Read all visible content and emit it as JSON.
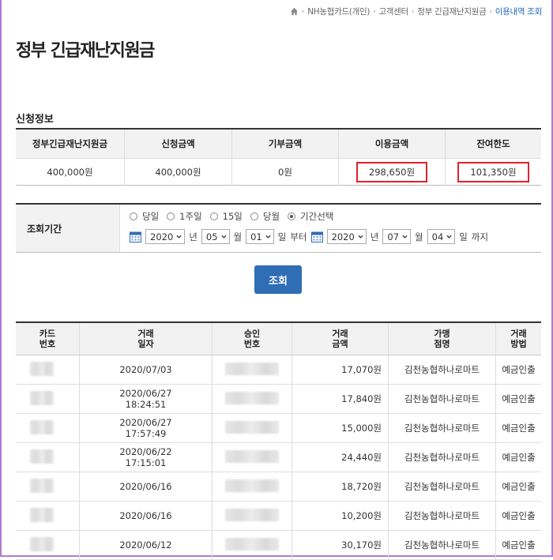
{
  "breadcrumb": {
    "items": [
      "NH농협카드(개인)",
      "고객센터",
      "정부 긴급재난지원금"
    ],
    "current": "이용내역 조회",
    "separator": "›"
  },
  "page_title": "정부 긴급재난지원금",
  "section_title": "신청정보",
  "info_table": {
    "headers": [
      "정부긴급재난지원금",
      "신청금액",
      "기부금액",
      "이용금액",
      "잔여한도"
    ],
    "values": [
      "400,000원",
      "400,000원",
      "0원",
      "298,650원",
      "101,350원"
    ]
  },
  "period": {
    "label": "조회기간",
    "options": [
      "당일",
      "1주일",
      "15일",
      "당월",
      "기간선택"
    ],
    "selected_index": 4,
    "start": {
      "year": "2020",
      "month": "05",
      "day": "01"
    },
    "end": {
      "year": "2020",
      "month": "07",
      "day": "04"
    },
    "units": {
      "year": "년",
      "month": "월",
      "day": "일",
      "from": "부터",
      "to": "까지"
    }
  },
  "search_button": "조회",
  "transactions": {
    "headers": [
      "카드\n번호",
      "거래\n일자",
      "승인\n번호",
      "거래\n금액",
      "가맹\n점명",
      "거래\n방법"
    ],
    "rows": [
      {
        "date": "2020/07/03",
        "amount": "17,070원",
        "merchant": "김천농협하나로마트",
        "method": "예금인출"
      },
      {
        "date": "2020/06/27\n18:24:51",
        "amount": "17,840원",
        "merchant": "김천농협하나로마트",
        "method": "예금인출"
      },
      {
        "date": "2020/06/27\n17:57:49",
        "amount": "15,000원",
        "merchant": "김천농협하나로마트",
        "method": "예금인출"
      },
      {
        "date": "2020/06/22\n17:15:01",
        "amount": "24,440원",
        "merchant": "김천농협하나로마트",
        "method": "예금인출"
      },
      {
        "date": "2020/06/16",
        "amount": "18,720원",
        "merchant": "김천농협하나로마트",
        "method": "예금인출"
      },
      {
        "date": "2020/06/16",
        "amount": "10,200원",
        "merchant": "김천농협하나로마트",
        "method": "예금인출"
      },
      {
        "date": "2020/06/12",
        "amount": "30,170원",
        "merchant": "김천농협하나로마트",
        "method": "예금인출"
      }
    ]
  },
  "colors": {
    "accent": "#2f6db5",
    "highlight_border": "#e0212a",
    "breadcrumb_current": "#1e66c0",
    "frame": "#b07ad0"
  },
  "icons": {
    "home": "home-icon",
    "calendar": "calendar-icon",
    "dropdown": "chevron-down-icon"
  }
}
